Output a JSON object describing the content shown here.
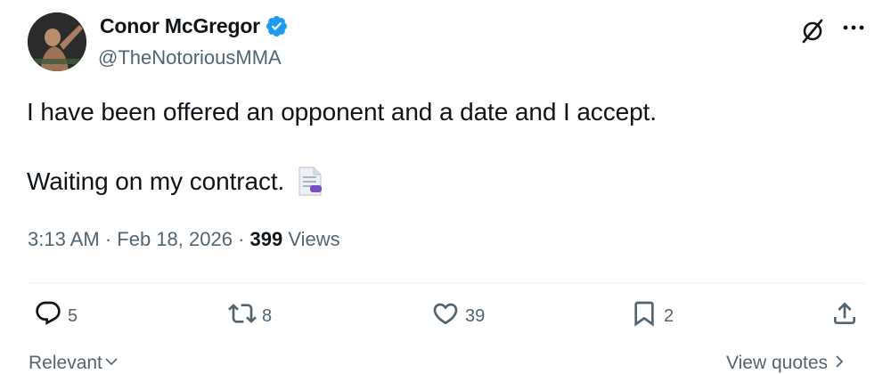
{
  "author": {
    "name": "Conor McGregor",
    "handle": "@TheNotoriousMMA",
    "verified_color": "#1d9bf0",
    "avatar_icon": "profile-photo"
  },
  "tweet": {
    "line1": "I have been offered an opponent and a date and I accept.",
    "line2": "Waiting on my contract.",
    "emoji_icon": "page-facing-up"
  },
  "meta": {
    "time": "3:13 AM",
    "sep1": " · ",
    "date": "Feb 18, 2026",
    "sep2": " · ",
    "views_count": "399",
    "views_label": " Views"
  },
  "actions": {
    "replies": "5",
    "reposts": "8",
    "likes": "39",
    "bookmarks": "2"
  },
  "footer": {
    "sort_label": "Relevant",
    "quotes_label": "View quotes"
  },
  "colors": {
    "text": "#0f1419",
    "secondary": "#536471",
    "accent": "#1d9bf0",
    "divider": "#eff3f4"
  }
}
